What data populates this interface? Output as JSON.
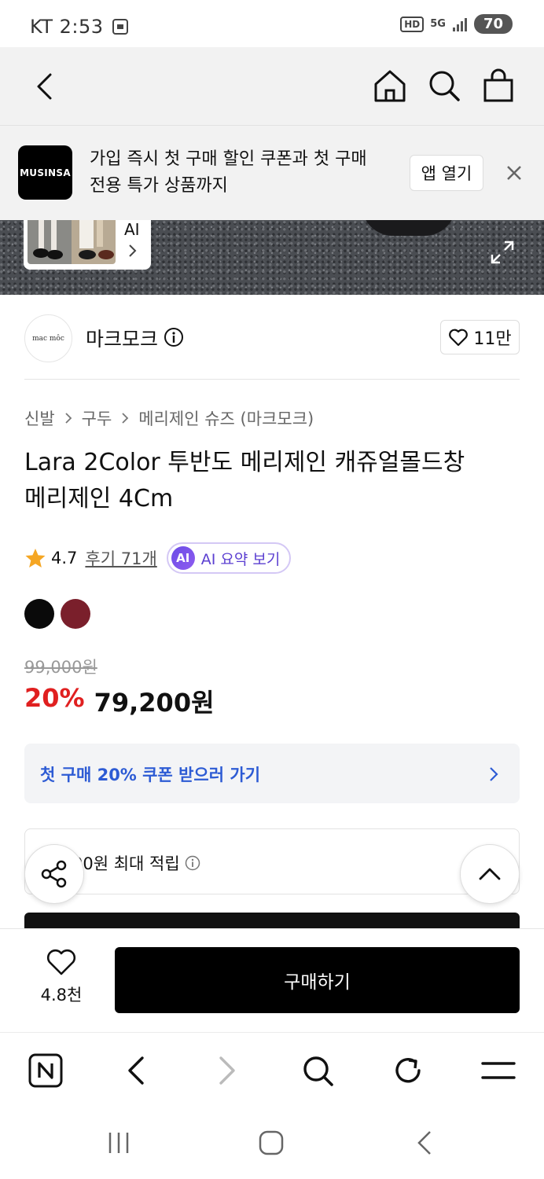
{
  "status_bar": {
    "carrier_time": "KT 2:53",
    "hd": "HD",
    "network": "5G",
    "battery": "70"
  },
  "app_banner": {
    "logo_text": "MUSINSA",
    "message_line1": "가입 즉시 첫 구매 할인 쿠폰과 첫 구매",
    "message_line2": "전용 특가 상품까지",
    "open_app_label": "앱 열기"
  },
  "hero": {
    "thumb_ai_label": "AI"
  },
  "brand": {
    "logo_text": "mac môc",
    "name": "마크모크",
    "likes": "11만"
  },
  "breadcrumb": [
    "신발",
    "구두",
    "메리제인 슈즈 (마크모크)"
  ],
  "product": {
    "title_line1": "Lara 2Color 투반도 메리제인 캐쥬얼몰드창",
    "title_line2": "메리제인 4Cm",
    "rating": "4.7",
    "review_link": "후기 71개",
    "ai_badge": "AI",
    "ai_summary_label": "AI 요약 보기",
    "colors": [
      "#0a0a0a",
      "#7a1f2b"
    ],
    "original_price": "99,000원",
    "discount_percent": "20%",
    "sale_price": "79,200원"
  },
  "coupon": {
    "label": "첫 구매 20% 쿠폰 받으러 가기"
  },
  "points": {
    "label": "00원 최대 적립"
  },
  "cta": {
    "wish_count": "4.8천",
    "buy_label": "구매하기"
  },
  "icons": {
    "back": "chevron-left-icon",
    "home": "home-icon",
    "search": "search-icon",
    "cart": "shopping-bag-icon",
    "close": "close-icon",
    "expand": "expand-icon",
    "info": "info-icon",
    "heart": "heart-icon",
    "star": "star-icon",
    "share": "share-icon",
    "scroll_top": "chevron-up-icon"
  },
  "colors": {
    "discount": "#e02020",
    "coupon": "#2d5bd4",
    "ai_accent": "#5b3fd1",
    "star": "#f5a623"
  }
}
